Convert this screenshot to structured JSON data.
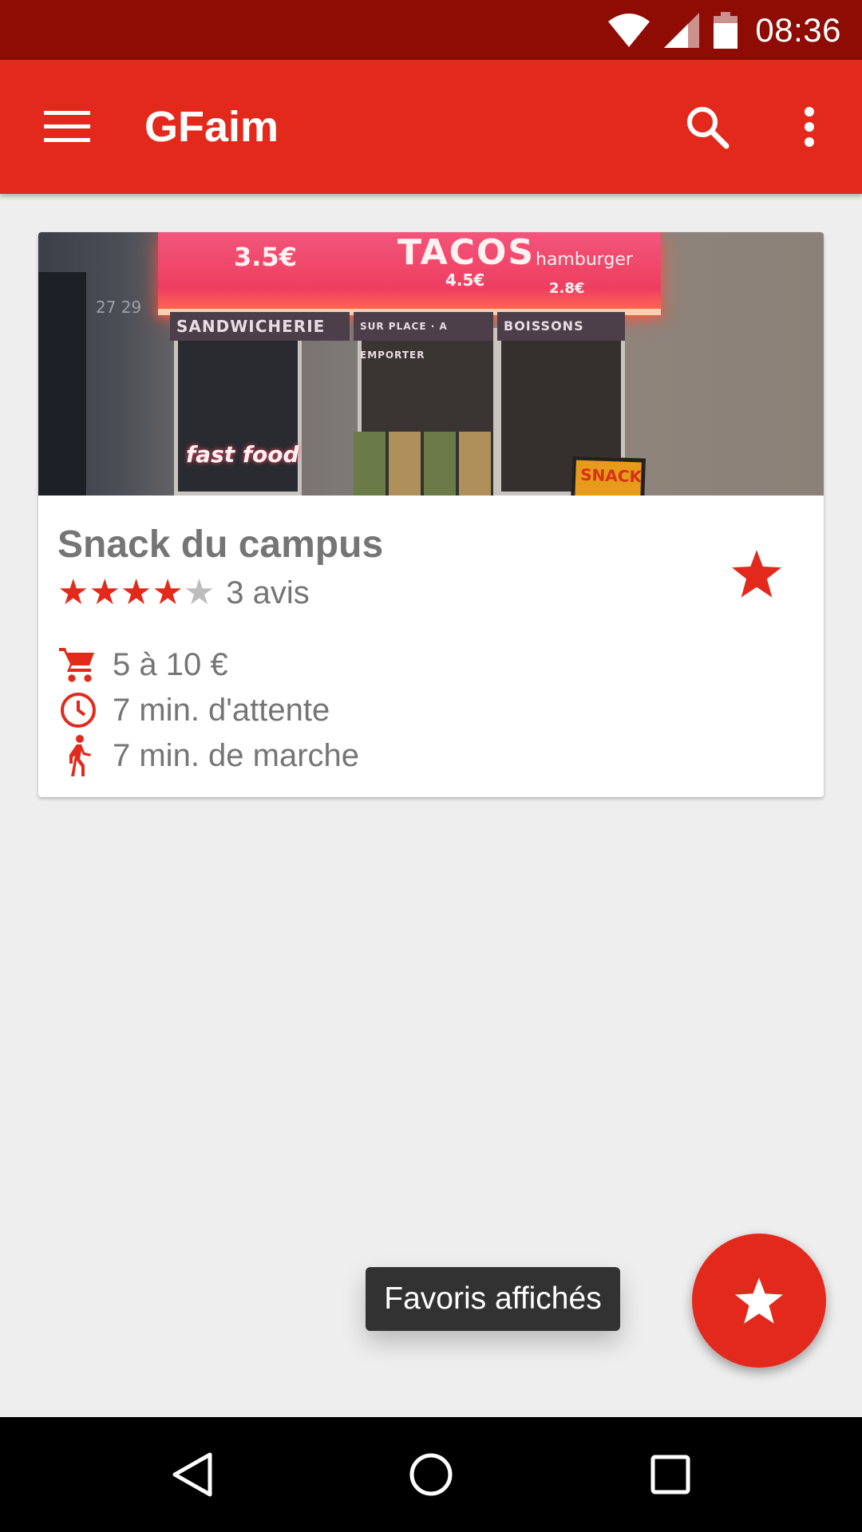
{
  "status_bar": {
    "time": "08:36",
    "icons": [
      "wifi-icon",
      "cell-signal-icon",
      "battery-icon"
    ]
  },
  "app_bar": {
    "title": "GFaim",
    "icons": [
      "menu-icon",
      "search-icon",
      "more-vert-icon"
    ]
  },
  "card": {
    "title": "Snack du campus",
    "rating": {
      "value": 4,
      "max": 5
    },
    "reviews": "3 avis",
    "favorite": true,
    "price": "5 à 10 €",
    "wait": "7 min. d'attente",
    "walk": "7 min. de marche",
    "photo_signs": {
      "price1": "3.5€",
      "tacos": "TACOS",
      "tacos_price": "4.5€",
      "hamburger": "hamburger",
      "hamburger_price": "2.8€",
      "sandwicherie": "SANDWICHERIE",
      "sur_place": "SUR PLACE · A EMPORTER",
      "boissons": "BOISSONS",
      "fast_food": "fast food",
      "snack": "SNACK",
      "number": "27 29"
    }
  },
  "toast": {
    "text": "Favoris affichés"
  },
  "colors": {
    "primary": "#e3291b",
    "primary_dark": "#8e0c04",
    "background": "#eeeeee",
    "text_secondary": "#757575",
    "toast_bg": "#323232"
  },
  "nav_bar": {
    "icons": [
      "back-icon",
      "home-icon",
      "recents-icon"
    ]
  }
}
